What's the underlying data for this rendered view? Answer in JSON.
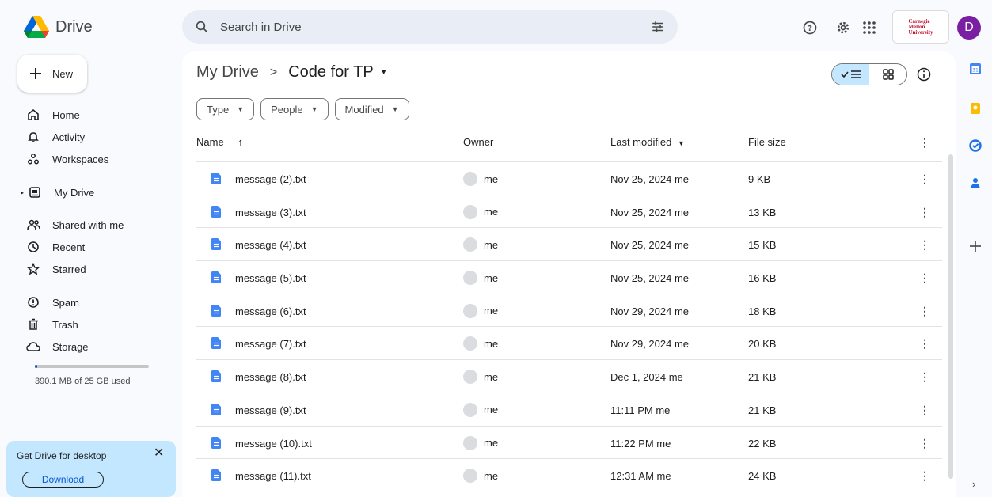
{
  "app": {
    "name": "Drive"
  },
  "search": {
    "placeholder": "Search in Drive"
  },
  "account": {
    "org_line1": "Carnegie",
    "org_line2": "Mellon",
    "org_line3": "University",
    "avatar_letter": "D"
  },
  "sidebar": {
    "new_label": "New",
    "items": [
      {
        "label": "Home",
        "icon": "home-icon"
      },
      {
        "label": "Activity",
        "icon": "bell-icon"
      },
      {
        "label": "Workspaces",
        "icon": "workspaces-icon"
      },
      {
        "label": "My Drive",
        "icon": "my-drive-icon"
      },
      {
        "label": "Shared with me",
        "icon": "people-icon"
      },
      {
        "label": "Recent",
        "icon": "clock-icon"
      },
      {
        "label": "Starred",
        "icon": "star-icon"
      },
      {
        "label": "Spam",
        "icon": "spam-icon"
      },
      {
        "label": "Trash",
        "icon": "trash-icon"
      },
      {
        "label": "Storage",
        "icon": "cloud-icon"
      }
    ],
    "storage_text": "390.1 MB of 25 GB used",
    "storage_used_fraction": 0.0156
  },
  "promo": {
    "title": "Get Drive for desktop",
    "button": "Download"
  },
  "breadcrumb": {
    "root": "My Drive",
    "separator": ">",
    "current": "Code for TP"
  },
  "filters": [
    "Type",
    "People",
    "Modified"
  ],
  "table": {
    "headers": {
      "name": "Name",
      "owner": "Owner",
      "modified": "Last modified",
      "size": "File size"
    },
    "rows": [
      {
        "name": "message (2).txt",
        "owner": "me",
        "modified": "Nov 25, 2024 me",
        "size": "9 KB"
      },
      {
        "name": "message (3).txt",
        "owner": "me",
        "modified": "Nov 25, 2024 me",
        "size": "13 KB"
      },
      {
        "name": "message (4).txt",
        "owner": "me",
        "modified": "Nov 25, 2024 me",
        "size": "15 KB"
      },
      {
        "name": "message (5).txt",
        "owner": "me",
        "modified": "Nov 25, 2024 me",
        "size": "16 KB"
      },
      {
        "name": "message (6).txt",
        "owner": "me",
        "modified": "Nov 29, 2024 me",
        "size": "18 KB"
      },
      {
        "name": "message (7).txt",
        "owner": "me",
        "modified": "Nov 29, 2024 me",
        "size": "20 KB"
      },
      {
        "name": "message (8).txt",
        "owner": "me",
        "modified": "Dec 1, 2024 me",
        "size": "21 KB"
      },
      {
        "name": "message (9).txt",
        "owner": "me",
        "modified": "11:11 PM me",
        "size": "21 KB"
      },
      {
        "name": "message (10).txt",
        "owner": "me",
        "modified": "11:22 PM me",
        "size": "22 KB"
      },
      {
        "name": "message (11).txt",
        "owner": "me",
        "modified": "12:31 AM me",
        "size": "24 KB"
      }
    ]
  },
  "colors": {
    "accent": "#0b57d0",
    "doc_icon": "#4285f4",
    "selected": "#c2e7ff"
  }
}
